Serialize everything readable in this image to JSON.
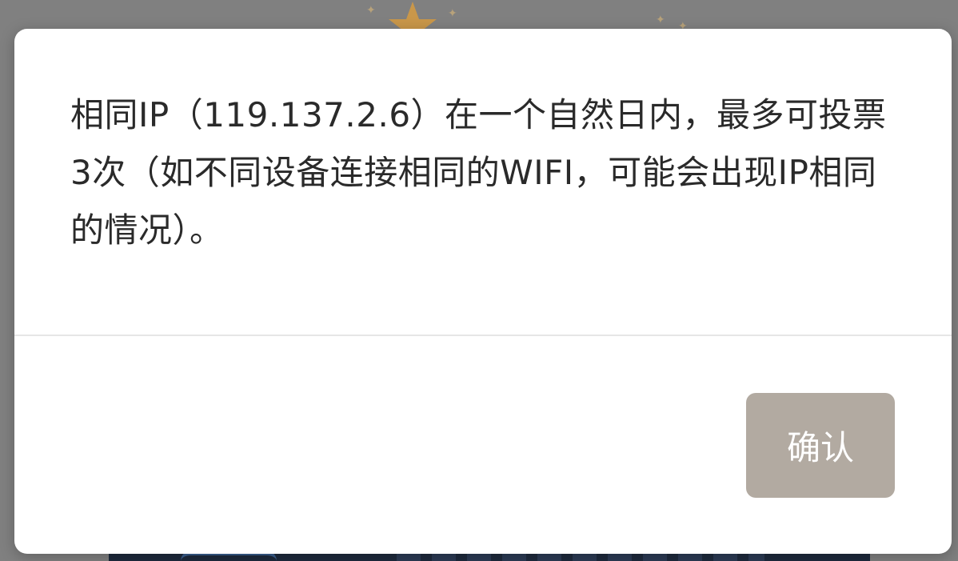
{
  "dialog": {
    "message": "相同IP（119.137.2.6）在一个自然日内，最多可投票3次（如不同设备连接相同的WIFI，可能会出现IP相同的情况）。",
    "confirm_label": "确认"
  },
  "colors": {
    "overlay": "#808080",
    "dialog_background": "#ffffff",
    "message_text": "#2a2a2a",
    "divider": "#e6e6e6",
    "button_background": "#b2aaa1",
    "button_text": "#ffffff",
    "background_star": "#d9a441",
    "background_banner": "#1e2a3d"
  },
  "icons": {
    "background_star": "star-icon",
    "background_sparkles": "sparkle-icon"
  }
}
